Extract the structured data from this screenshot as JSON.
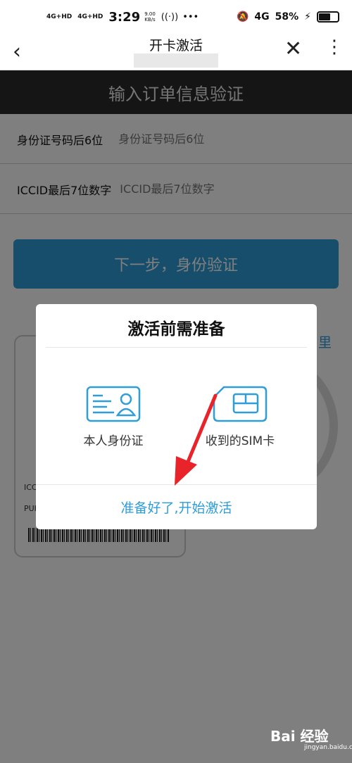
{
  "status_bar": {
    "network1": "4G+HD",
    "network2": "4G+HD",
    "time": "3:29",
    "speed_value": "9.00",
    "speed_unit": "KB/s",
    "network3": "4G",
    "battery": "58%"
  },
  "nav": {
    "title": "开卡激活"
  },
  "page": {
    "header": "输入订单信息验证",
    "fields": [
      {
        "label": "身份证号码后6位",
        "placeholder": "身份证号码后6位"
      },
      {
        "label": "ICCID最后7位数字",
        "placeholder": "ICCID最后7位数字"
      }
    ],
    "next_button": "下一步，身份验证",
    "here_link": "里",
    "card_iccid_label": "ICC",
    "card_puk_label": "PUK"
  },
  "modal": {
    "title": "激活前需准备",
    "items": [
      {
        "label": "本人身份证",
        "icon": "id-card-icon"
      },
      {
        "label": "收到的SIM卡",
        "icon": "sim-card-icon"
      }
    ],
    "start_button": "准备好了,开始激活"
  },
  "watermark": {
    "brand": "Bai 经验",
    "domain": "jingyan.baidu.com"
  },
  "colors": {
    "accent": "#2f9dd8",
    "header_bg": "#2a2a2a",
    "arrow": "#e8232a"
  }
}
